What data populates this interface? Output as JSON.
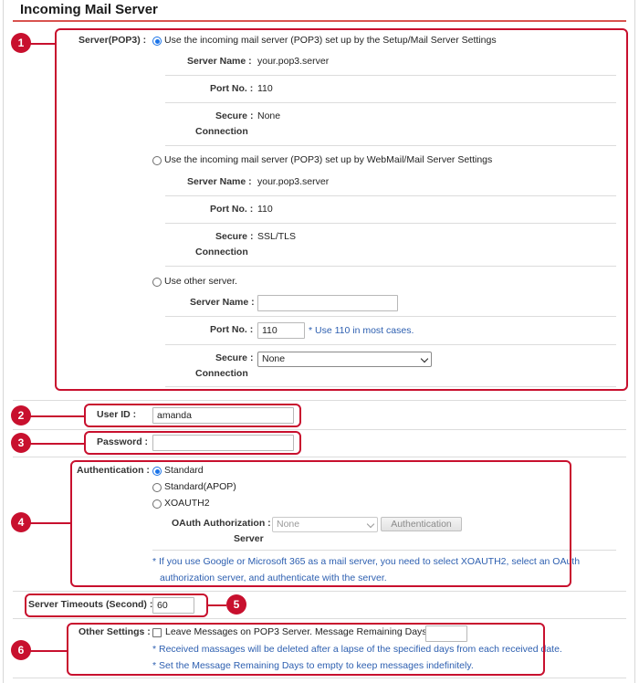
{
  "title": "Incoming Mail Server",
  "server": {
    "label": "Server(POP3)",
    "option1": {
      "label": "Use the incoming mail server (POP3) set up by the Setup/Mail Server Settings",
      "server_name_label": "Server Name",
      "server_name": "your.pop3.server",
      "port_label": "Port No.",
      "port": "110",
      "secure_label_1": "Secure",
      "secure_label_2": "Connection",
      "secure": "None"
    },
    "option2": {
      "label": "Use the incoming mail server (POP3) set up by WebMail/Mail Server Settings",
      "server_name_label": "Server Name",
      "server_name": "your.pop3.server",
      "port_label": "Port No.",
      "port": "110",
      "secure_label_1": "Secure",
      "secure_label_2": "Connection",
      "secure": "SSL/TLS"
    },
    "option3": {
      "label": "Use other server.",
      "server_name_label": "Server Name",
      "server_name_value": "",
      "port_label": "Port No.",
      "port_value": "110",
      "port_note": "* Use 110 in most cases.",
      "secure_label_1": "Secure",
      "secure_label_2": "Connection",
      "secure_selected": "None"
    }
  },
  "user_id": {
    "label": "User ID",
    "value": "amanda"
  },
  "password": {
    "label": "Password",
    "value": ""
  },
  "authentication": {
    "label": "Authentication",
    "options": [
      "Standard",
      "Standard(APOP)",
      "XOAUTH2"
    ],
    "oauth_label_1": "OAuth Authorization",
    "oauth_label_2": "Server",
    "oauth_selected": "None",
    "button": "Authentication",
    "note_1": "* If you use Google or Microsoft 365 as a mail server, you need to select XOAUTH2, select an OAuth",
    "note_2": "authorization server, and authenticate with the server."
  },
  "timeout": {
    "label": "Server Timeouts (Second)",
    "value": "60"
  },
  "other": {
    "label": "Other Settings",
    "checkbox_label": "Leave Messages on POP3 Server. Message Remaining Days",
    "days_value": "",
    "note_1": "* Received massages will be deleted after a lapse of the specified days from each received date.",
    "note_2": "* Set the Message Remaining Days to empty to keep messages indefinitely."
  },
  "badges": [
    "1",
    "2",
    "3",
    "4",
    "5",
    "6"
  ],
  "colors": {
    "accent": "#c8102e",
    "note": "#2d5fb0",
    "radio": "#1a73e8"
  }
}
